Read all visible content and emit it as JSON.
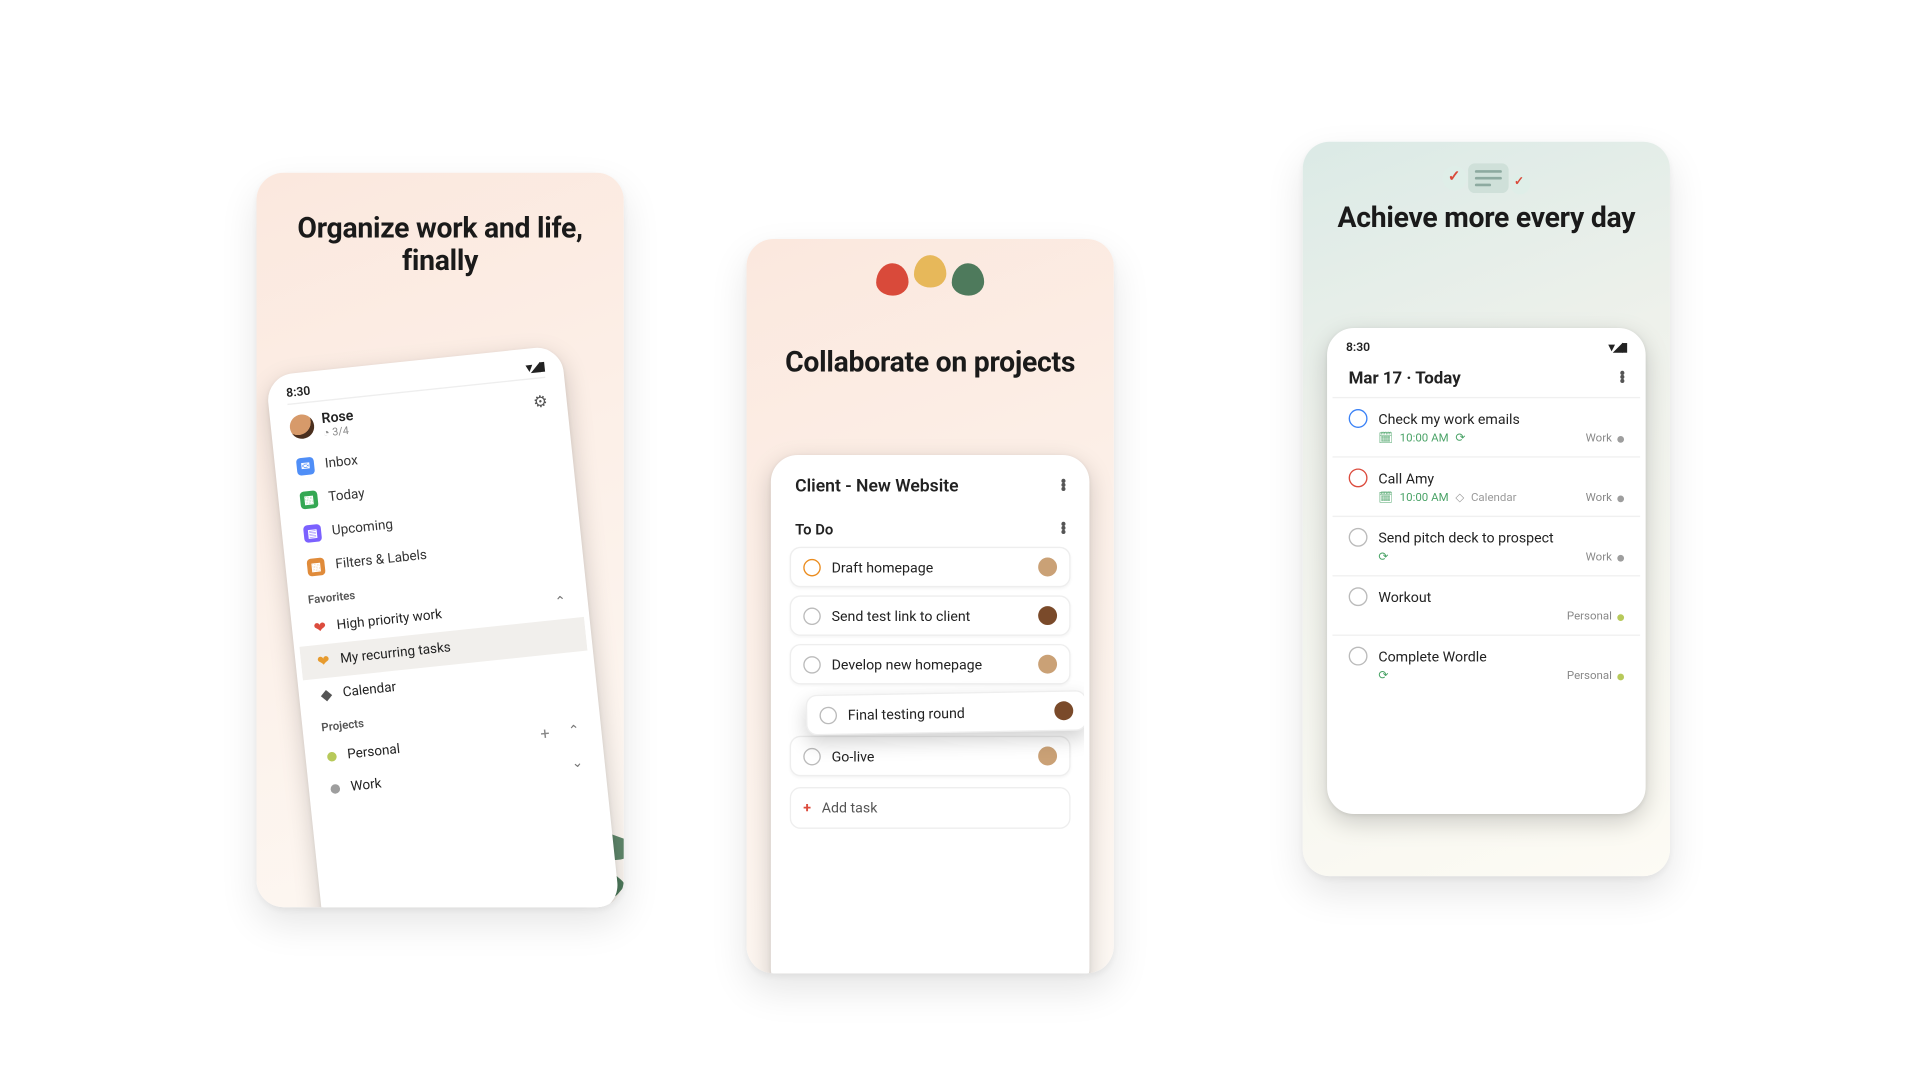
{
  "card1": {
    "headline": "Organize work and life, finally",
    "status_time": "8:30",
    "user_name": "Rose",
    "user_progress": "3/4",
    "nav": {
      "inbox": "Inbox",
      "today": "Today",
      "upcoming": "Upcoming",
      "filters": "Filters & Labels"
    },
    "favorites_label": "Favorites",
    "favorites": [
      {
        "label": "High priority work",
        "color": "#dc4c3e"
      },
      {
        "label": "My recurring tasks",
        "color": "#e79b2e"
      },
      {
        "label": "Calendar",
        "color": "#555"
      }
    ],
    "projects_label": "Projects",
    "projects": [
      {
        "label": "Personal",
        "color": "#b7c95a"
      },
      {
        "label": "Work",
        "color": "#9e9e9e"
      }
    ]
  },
  "card2": {
    "headline": "Collaborate on projects",
    "project_title": "Client - New Website",
    "section": "To Do",
    "tasks": [
      {
        "label": "Draft homepage",
        "circle": "orange",
        "avatar": "#caa176"
      },
      {
        "label": "Send test link to client",
        "circle": "grey",
        "avatar": "#7a4a2a"
      },
      {
        "label": "Develop new homepage",
        "circle": "grey",
        "avatar": "#caa176"
      },
      {
        "label": "Final testing round",
        "circle": "grey",
        "avatar": "#7a4a2a",
        "dragging": true
      },
      {
        "label": "Go-live",
        "circle": "grey",
        "avatar": "#caa176"
      }
    ],
    "add_task": "Add task"
  },
  "card3": {
    "headline": "Achieve more every day",
    "status_time": "8:30",
    "date_title": "Mar 17 · Today",
    "tasks": [
      {
        "label": "Check my work emails",
        "circle": "blue",
        "time": "10:00 AM",
        "recurring": true,
        "project": "Work",
        "dot": "#9e9e9e"
      },
      {
        "label": "Call Amy",
        "circle": "red",
        "time": "10:00 AM",
        "extra": "Calendar",
        "project": "Work",
        "dot": "#9e9e9e"
      },
      {
        "label": "Send pitch deck to prospect",
        "circle": "grey",
        "recurring": true,
        "project": "Work",
        "dot": "#9e9e9e"
      },
      {
        "label": "Workout",
        "circle": "grey",
        "project": "Personal",
        "dot": "#b7c95a"
      },
      {
        "label": "Complete Wordle",
        "circle": "grey",
        "recurring": true,
        "project": "Personal",
        "dot": "#b7c95a"
      }
    ]
  }
}
